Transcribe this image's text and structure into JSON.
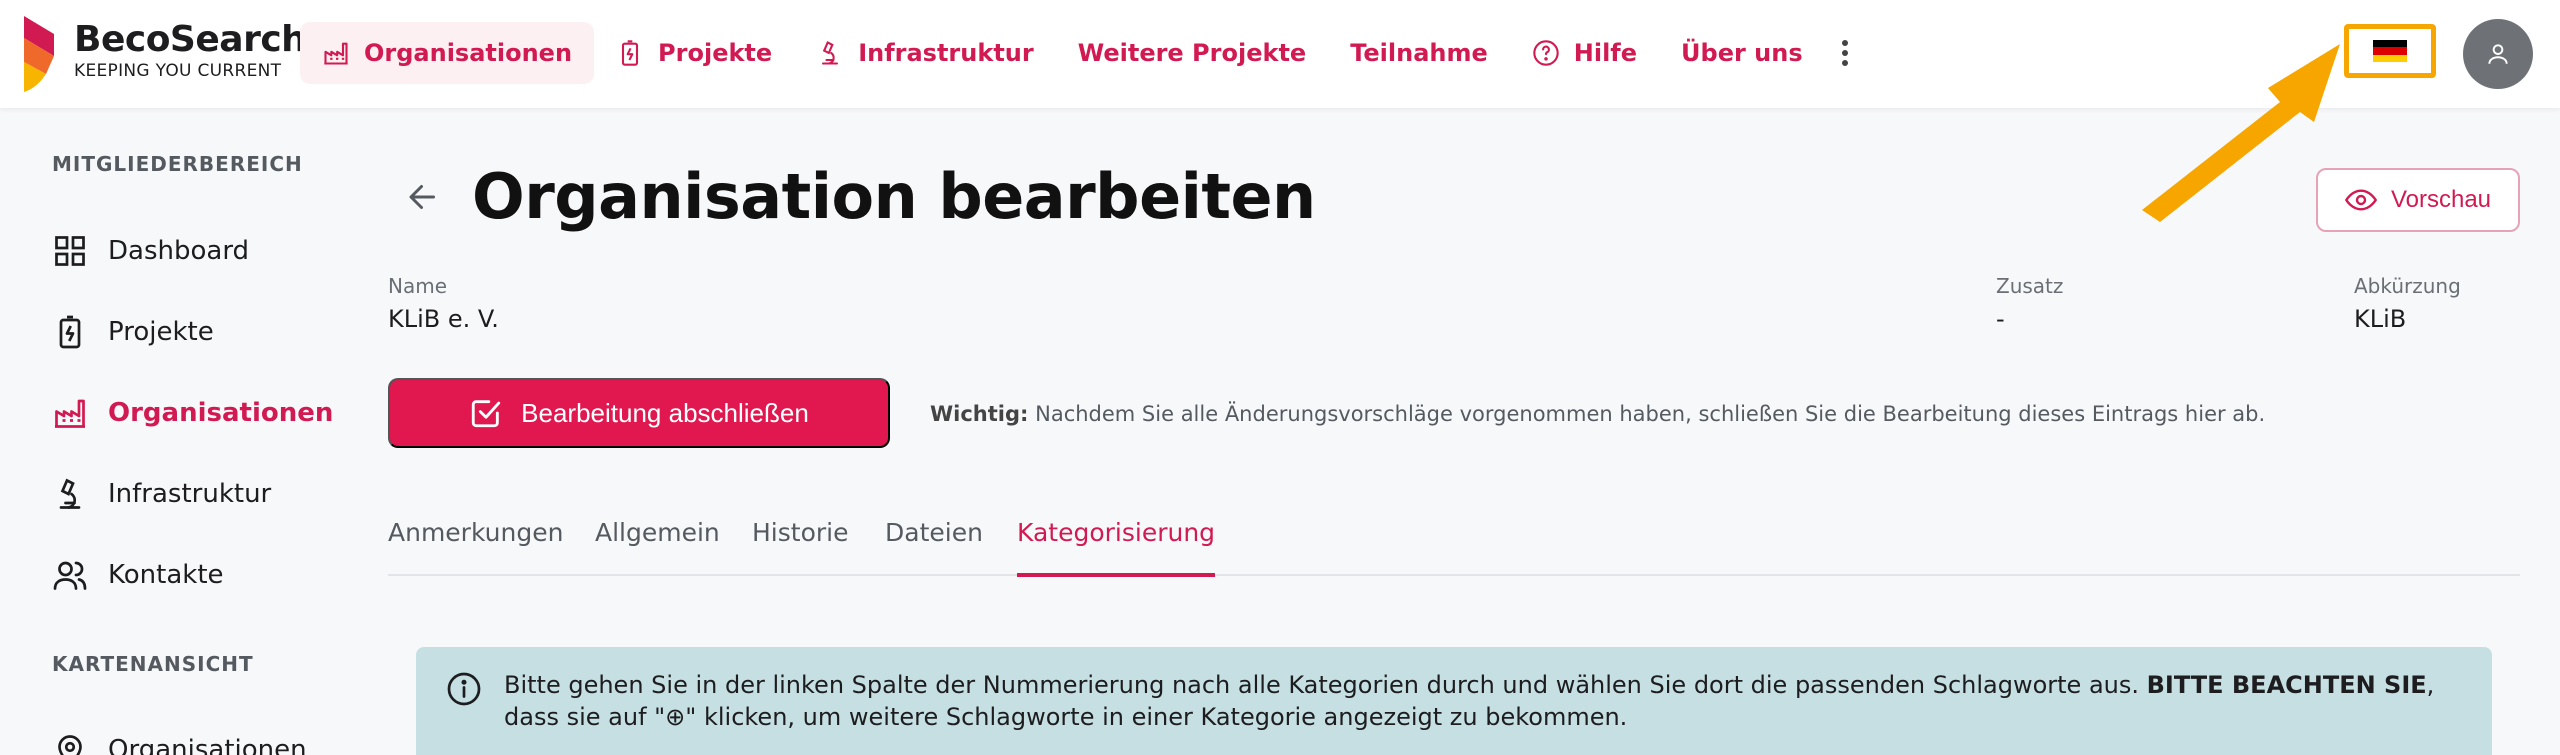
{
  "brand": {
    "name": "BecoSearch",
    "tagline": "KEEPING YOU CURRENT"
  },
  "nav": {
    "items": [
      {
        "label": "Organisationen",
        "icon": "factory-icon",
        "active": true
      },
      {
        "label": "Projekte",
        "icon": "battery-icon"
      },
      {
        "label": "Infrastruktur",
        "icon": "microscope-icon"
      },
      {
        "label": "Weitere Projekte"
      },
      {
        "label": "Teilnahme"
      },
      {
        "label": "Hilfe",
        "icon": "help-circle-icon"
      },
      {
        "label": "Über uns"
      }
    ],
    "more_icon": "more-vertical-icon",
    "language_flag": "german-flag-icon",
    "avatar_icon": "user-icon"
  },
  "sidebar": {
    "member_section": "MITGLIEDERBEREICH",
    "member_items": [
      {
        "label": "Dashboard",
        "icon": "grid-icon"
      },
      {
        "label": "Projekte",
        "icon": "battery-icon"
      },
      {
        "label": "Organisationen",
        "icon": "factory-icon",
        "active": true
      },
      {
        "label": "Infrastruktur",
        "icon": "microscope-icon"
      },
      {
        "label": "Kontakte",
        "icon": "users-icon"
      }
    ],
    "map_section": "KARTENANSICHT",
    "map_items": [
      {
        "label": "Organisationen",
        "icon": "map-pin-icon"
      }
    ]
  },
  "main": {
    "title": "Organisation bearbeiten",
    "preview_label": "Vorschau",
    "fields": {
      "name_label": "Name",
      "name_value": "KLiB e. V.",
      "zusatz_label": "Zusatz",
      "zusatz_value": "-",
      "abk_label": "Abkürzung",
      "abk_value": "KLiB"
    },
    "finish_label": "Bearbeitung abschließen",
    "notice_strong": "Wichtig:",
    "notice_text": " Nachdem Sie alle Änderungsvorschläge vorgenommen haben, schließen Sie die Bearbeitung dieses Eintrags hier ab.",
    "tabs": [
      {
        "label": "Anmerkungen"
      },
      {
        "label": "Allgemein"
      },
      {
        "label": "Historie"
      },
      {
        "label": "Dateien"
      },
      {
        "label": "Kategorisierung",
        "active": true
      }
    ],
    "info": {
      "text_a": "Bitte gehen Sie in der linken Spalte der Nummerierung nach alle Kategorien durch und wählen Sie dort die passenden Schlagworte aus. ",
      "text_strong": "BITTE BEACHTEN SIE",
      "text_b": ", dass sie auf \"⊕\" klicken, um weitere Schlagworte in einer Kategorie angezeigt zu bekommen."
    }
  },
  "colors": {
    "accent": "#d21a52",
    "primary_button": "#e0184f",
    "highlight": "#f7a600",
    "info_bg": "#c5dfe3"
  }
}
